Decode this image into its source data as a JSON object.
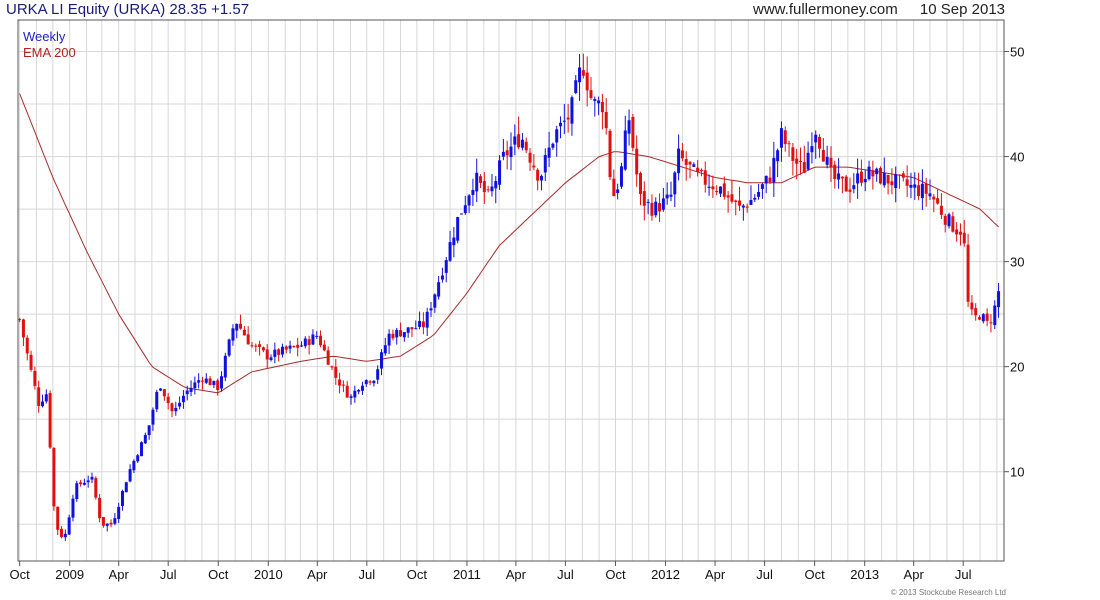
{
  "header": {
    "security": "URKA LI Equity (URKA)",
    "last": "28.35",
    "change": "+1.57",
    "site": "www.fullermoney.com",
    "date": "10 Sep 2013"
  },
  "legend": {
    "series": "Weekly",
    "indicator": "EMA 200"
  },
  "copyright": "© 2013 Stockcube Research Ltd",
  "colors": {
    "up": "#1010e0",
    "down": "#e01010",
    "ema": "#a52a2a",
    "grid": "#d8d8d8",
    "frame": "#555555"
  },
  "chart_data": {
    "type": "candlestick",
    "title": "URKA LI Equity (URKA) 28.35 +1.57",
    "frequency": "Weekly",
    "x_ticks": [
      "Oct",
      "2009",
      "Apr",
      "Jul",
      "Oct",
      "2010",
      "Apr",
      "Jul",
      "Oct",
      "2011",
      "Apr",
      "Jul",
      "Oct",
      "2012",
      "Apr",
      "Jul",
      "Oct",
      "2013",
      "Apr",
      "Jul"
    ],
    "y_ticks": [
      10,
      20,
      30,
      40,
      50
    ],
    "ylim": [
      1.5,
      53
    ],
    "grid": true,
    "y_axis_side": "right",
    "legend_position": "top-left",
    "close_anchors": [
      [
        "2008-10-01",
        24.5
      ],
      [
        "2008-10-20",
        20.0
      ],
      [
        "2008-11-05",
        16.5
      ],
      [
        "2008-11-20",
        17.5
      ],
      [
        "2008-12-05",
        5.0
      ],
      [
        "2008-12-22",
        3.5
      ],
      [
        "2009-01-10",
        8.5
      ],
      [
        "2009-02-10",
        9.5
      ],
      [
        "2009-02-28",
        5.0
      ],
      [
        "2009-03-20",
        5.0
      ],
      [
        "2009-04-20",
        10.0
      ],
      [
        "2009-05-25",
        14.0
      ],
      [
        "2009-06-15",
        18.5
      ],
      [
        "2009-07-10",
        15.5
      ],
      [
        "2009-08-01",
        17.5
      ],
      [
        "2009-09-01",
        19.0
      ],
      [
        "2009-10-01",
        18.0
      ],
      [
        "2009-11-01",
        24.5
      ],
      [
        "2009-12-01",
        22.0
      ],
      [
        "2009-12-31",
        21.0
      ],
      [
        "2010-03-01",
        22.0
      ],
      [
        "2010-04-01",
        23.0
      ],
      [
        "2010-05-05",
        19.0
      ],
      [
        "2010-06-01",
        17.0
      ],
      [
        "2010-06-20",
        18.5
      ],
      [
        "2010-07-15",
        19.0
      ],
      [
        "2010-08-10",
        23.0
      ],
      [
        "2010-09-15",
        23.5
      ],
      [
        "2010-10-15",
        24.0
      ],
      [
        "2010-11-15",
        29.0
      ],
      [
        "2010-12-15",
        34.0
      ],
      [
        "2011-01-15",
        38.0
      ],
      [
        "2011-02-10",
        36.0
      ],
      [
        "2011-03-10",
        40.0
      ],
      [
        "2011-04-10",
        42.0
      ],
      [
        "2011-05-15",
        38.0
      ],
      [
        "2011-06-10",
        42.0
      ],
      [
        "2011-07-10",
        44.0
      ],
      [
        "2011-08-01",
        49.0
      ],
      [
        "2011-08-20",
        45.0
      ],
      [
        "2011-09-10",
        45.0
      ],
      [
        "2011-09-25",
        36.0
      ],
      [
        "2011-10-10",
        38.0
      ],
      [
        "2011-10-25",
        44.0
      ],
      [
        "2011-11-15",
        36.0
      ],
      [
        "2011-12-10",
        35.0
      ],
      [
        "2012-01-10",
        36.0
      ],
      [
        "2012-01-25",
        40.0
      ],
      [
        "2012-03-01",
        38.0
      ],
      [
        "2012-04-10",
        37.0
      ],
      [
        "2012-05-15",
        35.0
      ],
      [
        "2012-06-10",
        36.0
      ],
      [
        "2012-07-10",
        38.0
      ],
      [
        "2012-08-01",
        42.0
      ],
      [
        "2012-08-20",
        40.0
      ],
      [
        "2012-09-10",
        38.5
      ],
      [
        "2012-10-01",
        43.0
      ],
      [
        "2012-11-01",
        38.0
      ],
      [
        "2012-12-01",
        37.0
      ],
      [
        "2013-01-01",
        38.5
      ],
      [
        "2013-02-01",
        38.0
      ],
      [
        "2013-03-01",
        37.5
      ],
      [
        "2013-04-01",
        37.0
      ],
      [
        "2013-05-01",
        36.5
      ],
      [
        "2013-06-01",
        34.0
      ],
      [
        "2013-06-20",
        33.0
      ],
      [
        "2013-07-01",
        33.0
      ],
      [
        "2013-07-10",
        26.0
      ],
      [
        "2013-07-20",
        24.5
      ],
      [
        "2013-08-01",
        25.0
      ],
      [
        "2013-08-15",
        24.0
      ],
      [
        "2013-08-25",
        25.0
      ],
      [
        "2013-09-10",
        28.35
      ]
    ],
    "ema_200": [
      [
        "2008-10-01",
        46.0
      ],
      [
        "2008-12-01",
        38.0
      ],
      [
        "2009-02-01",
        31.0
      ],
      [
        "2009-04-01",
        25.0
      ],
      [
        "2009-06-01",
        20.0
      ],
      [
        "2009-08-01",
        18.0
      ],
      [
        "2009-10-01",
        17.5
      ],
      [
        "2009-12-01",
        19.5
      ],
      [
        "2010-03-01",
        20.5
      ],
      [
        "2010-05-01",
        21.0
      ],
      [
        "2010-07-01",
        20.5
      ],
      [
        "2010-09-01",
        21.0
      ],
      [
        "2010-11-01",
        23.0
      ],
      [
        "2011-01-01",
        27.0
      ],
      [
        "2011-03-01",
        31.5
      ],
      [
        "2011-05-01",
        34.5
      ],
      [
        "2011-07-01",
        37.5
      ],
      [
        "2011-09-01",
        40.0
      ],
      [
        "2011-10-01",
        40.5
      ],
      [
        "2011-12-01",
        40.0
      ],
      [
        "2012-02-01",
        39.0
      ],
      [
        "2012-04-01",
        38.0
      ],
      [
        "2012-06-01",
        37.5
      ],
      [
        "2012-08-01",
        37.5
      ],
      [
        "2012-10-01",
        39.0
      ],
      [
        "2012-12-01",
        39.0
      ],
      [
        "2013-02-01",
        38.5
      ],
      [
        "2013-04-01",
        38.0
      ],
      [
        "2013-06-01",
        36.5
      ],
      [
        "2013-08-01",
        35.0
      ],
      [
        "2013-09-10",
        33.0
      ]
    ]
  }
}
